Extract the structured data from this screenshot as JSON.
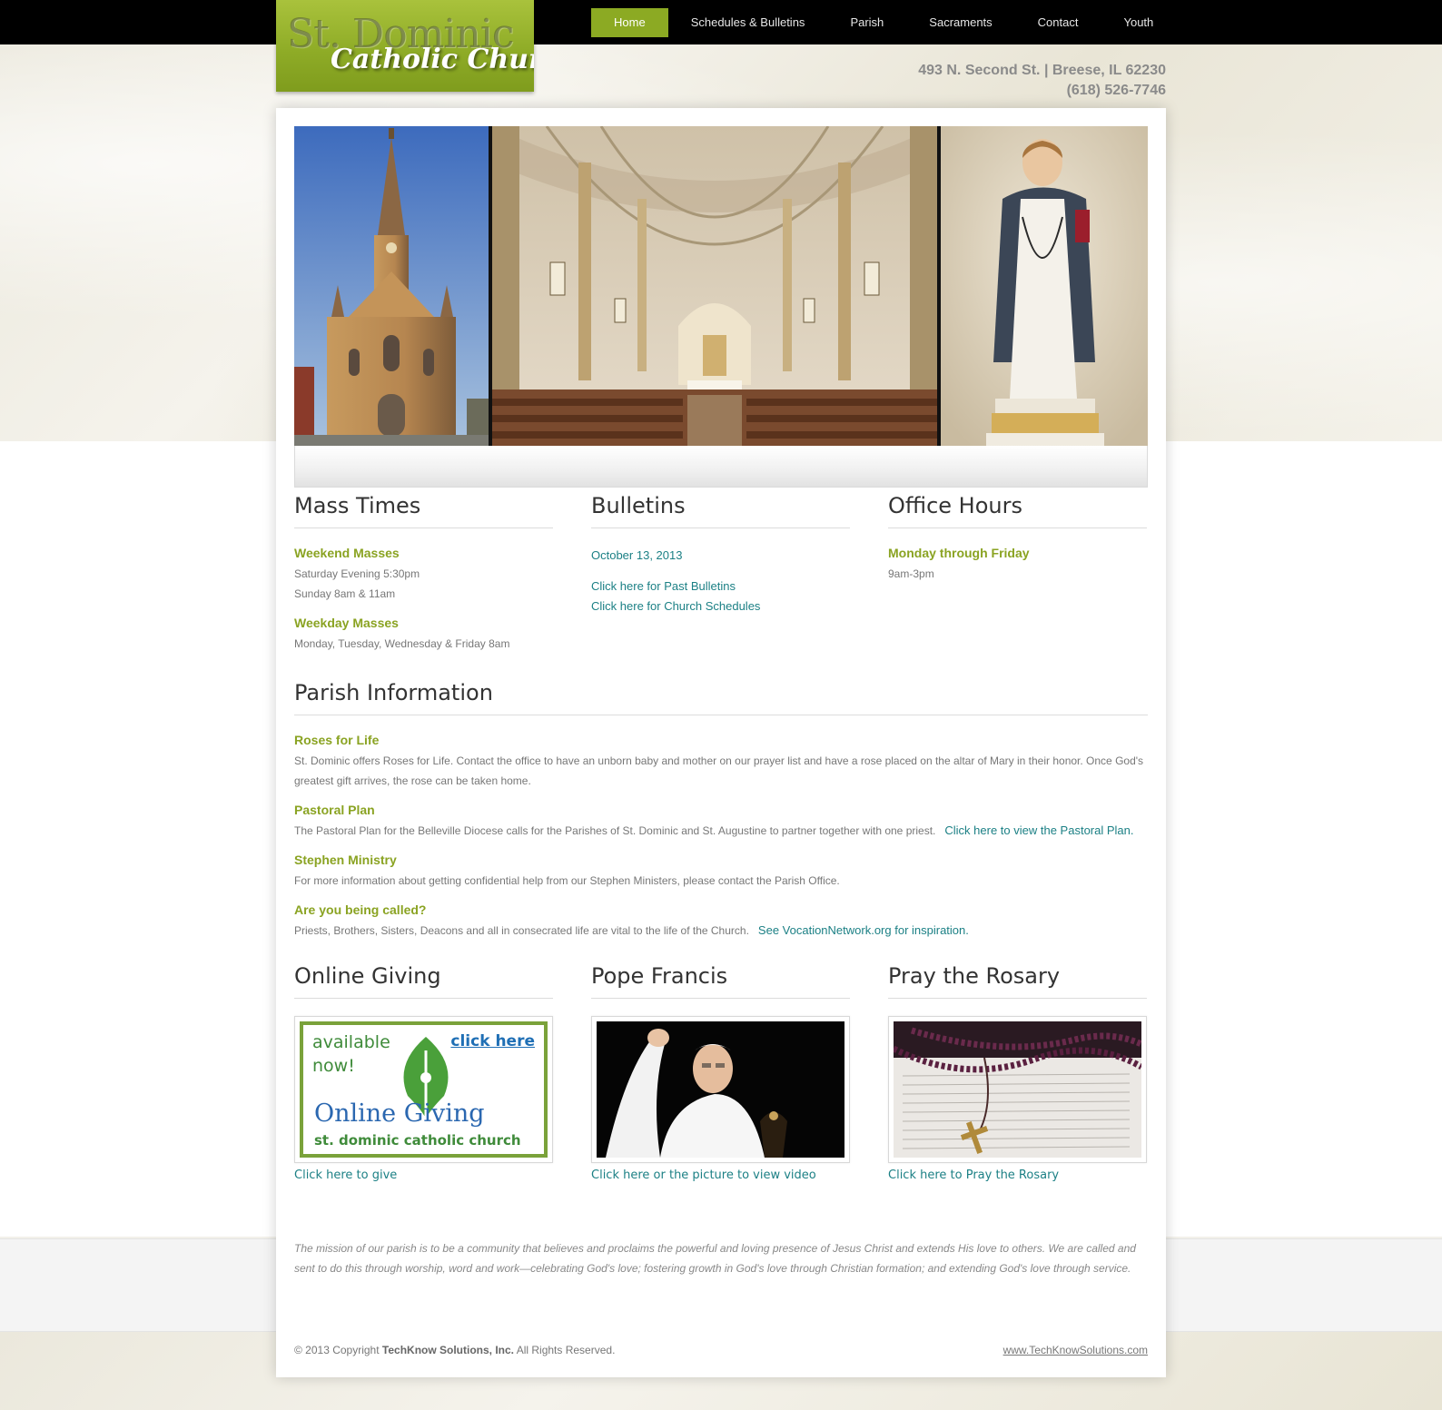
{
  "logo": {
    "line1": "St. Dominic",
    "line2": "Catholic Church"
  },
  "nav": [
    {
      "label": "Home",
      "active": true
    },
    {
      "label": "Schedules & Bulletins"
    },
    {
      "label": "Parish"
    },
    {
      "label": "Sacraments"
    },
    {
      "label": "Contact"
    },
    {
      "label": "Youth"
    }
  ],
  "address": {
    "street": "493 N. Second St. | Breese, IL 62230",
    "phone": "(618) 526-7746"
  },
  "mass_times": {
    "title": "Mass Times",
    "weekend_heading": "Weekend Masses",
    "weekend_line1": "Saturday Evening 5:30pm",
    "weekend_line2": "Sunday 8am & 11am",
    "weekday_heading": "Weekday Masses",
    "weekday_line1": "Monday, Tuesday, Wednesday & Friday 8am"
  },
  "bulletins": {
    "title": "Bulletins",
    "date_link": "October 13, 2013",
    "past_link": "Click here for Past Bulletins",
    "schedules_link": "Click here for Church Schedules"
  },
  "office_hours": {
    "title": "Office Hours",
    "heading": "Monday through Friday",
    "hours": "9am-3pm"
  },
  "parish_info": {
    "title": "Parish Information",
    "items": [
      {
        "heading": "Roses for Life",
        "text": "St. Dominic offers Roses for Life. Contact the office to have an unborn baby and mother on our prayer list and have a rose placed on the altar of Mary in their honor. Once God's greatest gift arrives, the rose can be taken home.",
        "link": ""
      },
      {
        "heading": "Pastoral Plan",
        "text": "The Pastoral Plan for the Belleville Diocese calls for the Parishes of St. Dominic and St. Augustine to partner together with one priest.",
        "link": "Click here to view the Pastoral Plan."
      },
      {
        "heading": "Stephen Ministry",
        "text": "For more information about getting confidential help from our Stephen Ministers, please contact the Parish Office.",
        "link": ""
      },
      {
        "heading": "Are you being called?",
        "text": "Priests, Brothers, Sisters, Deacons and all in consecrated life are vital to the life of the Church.",
        "link": "See VocationNetwork.org for inspiration."
      }
    ]
  },
  "online_giving": {
    "title": "Online Giving",
    "banner_available": "available",
    "banner_now": "now!",
    "banner_click": "click here",
    "banner_online": "Online",
    "banner_giving": "Giving",
    "banner_church": "st. dominic catholic church",
    "link": "Click here to give"
  },
  "pope": {
    "title": "Pope Francis",
    "link": "Click here or the picture to view video"
  },
  "rosary": {
    "title": "Pray the Rosary",
    "link": "Click here to Pray the Rosary"
  },
  "mission": "The mission of our parish is to be a community that believes and proclaims the powerful and loving presence of Jesus Christ and extends His love to others. We are called and sent to do this through worship, word and work—celebrating God's love; fostering growth in God's love through Christian formation; and extending God's love through service.",
  "footer": {
    "copyright_prefix": "© 2013 Copyright ",
    "copyright_company": "TechKnow Solutions, Inc.",
    "copyright_suffix": " All Rights Reserved.",
    "site_link": "www.TechKnowSolutions.com"
  },
  "colors": {
    "accent_green": "#8caa23",
    "link_teal": "#1c8085",
    "heading_gray": "#333333"
  }
}
